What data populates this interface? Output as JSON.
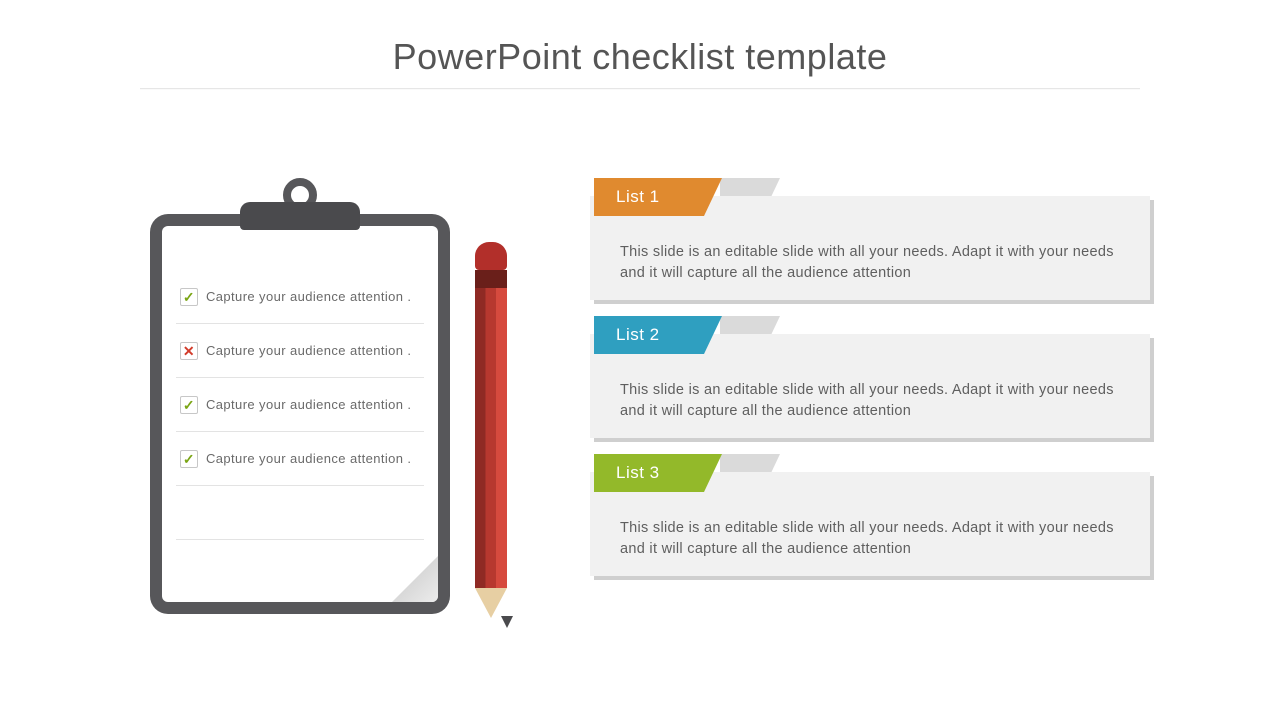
{
  "title": "PowerPoint checklist template",
  "clipboard": {
    "items": [
      {
        "text": "Capture your audience attention .",
        "status": "check"
      },
      {
        "text": "Capture your audience attention .",
        "status": "cross"
      },
      {
        "text": "Capture your audience attention .",
        "status": "check"
      },
      {
        "text": "Capture your audience attention .",
        "status": "check"
      }
    ]
  },
  "lists": [
    {
      "label": "List 1",
      "color": "orange",
      "body": "This slide is an editable slide with all your needs. Adapt it with your needs and it will capture all the audience attention"
    },
    {
      "label": "List 2",
      "color": "blue",
      "body": "This slide is an editable slide with all your needs. Adapt it with your needs and it will capture all the audience attention"
    },
    {
      "label": "List 3",
      "color": "green",
      "body": "This slide is an editable slide with all your needs. Adapt it with your needs and it will capture all the audience attention"
    }
  ],
  "colors": {
    "orange": "#e08a2f",
    "blue": "#2f9fc0",
    "green": "#93b92a"
  }
}
